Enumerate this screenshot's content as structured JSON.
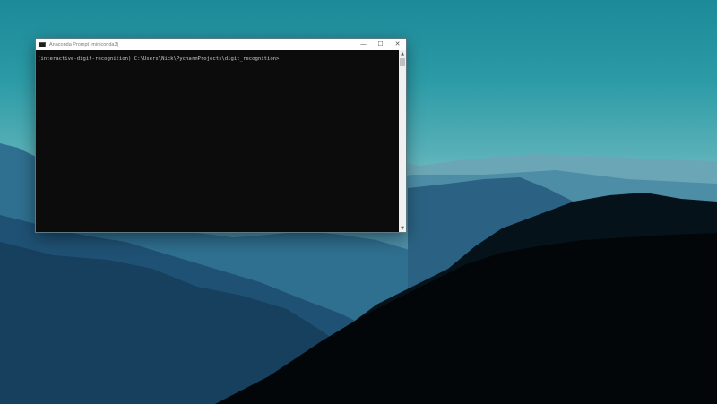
{
  "window": {
    "title": "Anaconda Prompt (miniconda3)",
    "controls": {
      "minimize": "—",
      "maximize": "☐",
      "close": "✕"
    }
  },
  "console": {
    "prompt": "(interactive-digit-recognition) C:\\Users\\Nick\\PycharmProjects\\digit_recognition>"
  },
  "scrollbar": {
    "up": "▲",
    "down": "▼"
  }
}
